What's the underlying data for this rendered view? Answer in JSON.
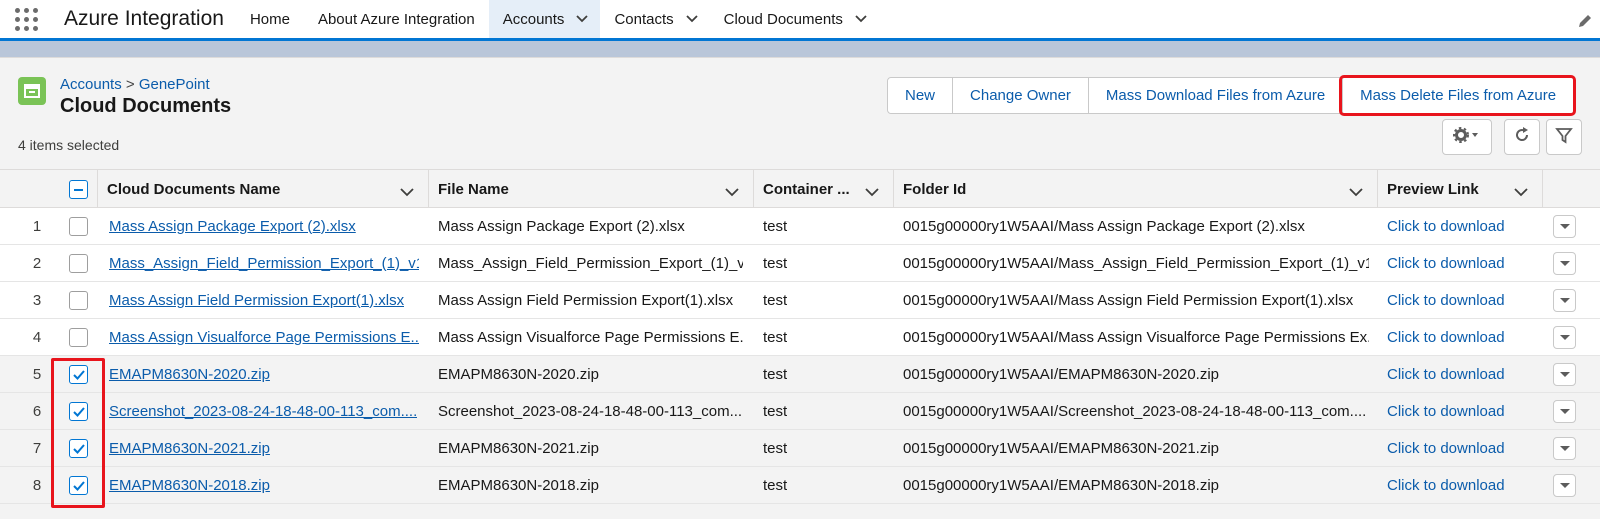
{
  "app": {
    "name": "Azure Integration"
  },
  "nav": {
    "items": [
      {
        "label": "Home",
        "has_menu": false,
        "active": false
      },
      {
        "label": "About Azure Integration",
        "has_menu": false,
        "active": false
      },
      {
        "label": "Accounts",
        "has_menu": true,
        "active": true
      },
      {
        "label": "Contacts",
        "has_menu": true,
        "active": false
      },
      {
        "label": "Cloud Documents",
        "has_menu": true,
        "active": false
      }
    ]
  },
  "header": {
    "breadcrumb_parent": "Accounts",
    "breadcrumb_sep": ">",
    "breadcrumb_record": "GenePoint",
    "title": "Cloud Documents",
    "selection_count": "4 items selected",
    "buttons": {
      "new": "New",
      "change_owner": "Change Owner",
      "mass_download": "Mass Download Files from Azure",
      "mass_delete": "Mass Delete Files from Azure"
    }
  },
  "table": {
    "columns": {
      "name": "Cloud Documents Name",
      "file": "File Name",
      "container": "Container ...",
      "folder": "Folder Id",
      "preview": "Preview Link"
    },
    "rows": [
      {
        "num": "1",
        "name": "Mass Assign Package Export (2).xlsx",
        "file": "Mass Assign Package Export (2).xlsx",
        "container": "test",
        "folder": "0015g00000ry1W5AAI/Mass Assign Package Export (2).xlsx",
        "preview": "Click to download",
        "checked": false
      },
      {
        "num": "2",
        "name": "Mass_Assign_Field_Permission_Export_(1)_v1...",
        "file": "Mass_Assign_Field_Permission_Export_(1)_v...",
        "container": "test",
        "folder": "0015g00000ry1W5AAI/Mass_Assign_Field_Permission_Export_(1)_v1...",
        "preview": "Click to download",
        "checked": false
      },
      {
        "num": "3",
        "name": "Mass Assign Field Permission Export(1).xlsx",
        "file": "Mass Assign Field Permission Export(1).xlsx",
        "container": "test",
        "folder": "0015g00000ry1W5AAI/Mass Assign Field Permission Export(1).xlsx",
        "preview": "Click to download",
        "checked": false
      },
      {
        "num": "4",
        "name": "Mass Assign Visualforce Page Permissions E...",
        "file": "Mass Assign Visualforce Page Permissions E...",
        "container": "test",
        "folder": "0015g00000ry1W5AAI/Mass Assign Visualforce Page Permissions Ex...",
        "preview": "Click to download",
        "checked": false
      },
      {
        "num": "5",
        "name": "EMAPM8630N-2020.zip",
        "file": "EMAPM8630N-2020.zip",
        "container": "test",
        "folder": "0015g00000ry1W5AAI/EMAPM8630N-2020.zip",
        "preview": "Click to download",
        "checked": true
      },
      {
        "num": "6",
        "name": "Screenshot_2023-08-24-18-48-00-113_com....",
        "file": "Screenshot_2023-08-24-18-48-00-113_com....",
        "container": "test",
        "folder": "0015g00000ry1W5AAI/Screenshot_2023-08-24-18-48-00-113_com....",
        "preview": "Click to download",
        "checked": true
      },
      {
        "num": "7",
        "name": "EMAPM8630N-2021.zip",
        "file": "EMAPM8630N-2021.zip",
        "container": "test",
        "folder": "0015g00000ry1W5AAI/EMAPM8630N-2021.zip",
        "preview": "Click to download",
        "checked": true
      },
      {
        "num": "8",
        "name": "EMAPM8630N-2018.zip",
        "file": "EMAPM8630N-2018.zip",
        "container": "test",
        "folder": "0015g00000ry1W5AAI/EMAPM8630N-2018.zip",
        "preview": "Click to download",
        "checked": true
      }
    ]
  },
  "colors": {
    "brand": "#0176d3",
    "link": "#0b5cab",
    "highlight": "#e8141c",
    "object_icon": "#7ac356"
  },
  "icons": {
    "app_launcher": "app-launcher-icon",
    "nav_menu": "chevron-down-icon",
    "edit": "pencil-icon",
    "object": "cloud-documents-icon",
    "settings": "gear-icon",
    "refresh": "refresh-icon",
    "filter": "filter-icon",
    "row_action": "chevron-down-icon"
  }
}
